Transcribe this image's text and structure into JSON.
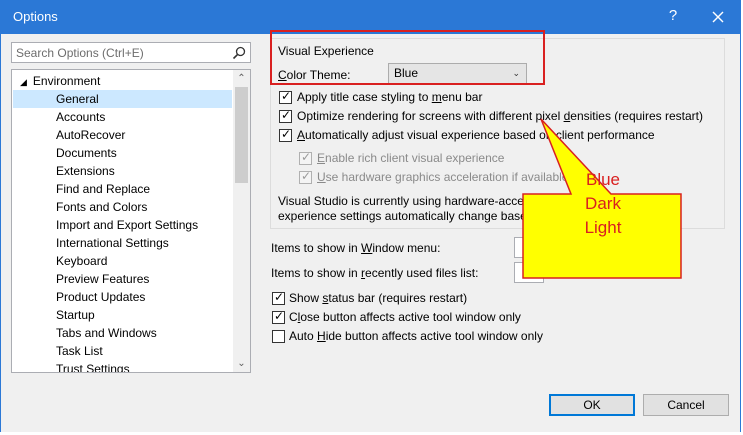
{
  "window": {
    "title": "Options",
    "help_label": "?"
  },
  "search": {
    "placeholder": "Search Options (Ctrl+E)"
  },
  "tree": {
    "root_label": "Environment",
    "items": [
      "General",
      "Accounts",
      "AutoRecover",
      "Documents",
      "Extensions",
      "Find and Replace",
      "Fonts and Colors",
      "Import and Export Settings",
      "International Settings",
      "Keyboard",
      "Preview Features",
      "Product Updates",
      "Startup",
      "Tabs and Windows",
      "Task List",
      "Trust Settings"
    ]
  },
  "visual_experience": {
    "group_label": "Visual Experience",
    "color_theme_label_pre": "",
    "color_theme_label_ul": "C",
    "color_theme_label_post": "olor Theme:",
    "color_theme_value": "Blue",
    "checkboxes": [
      {
        "pre": "Apply title case styling to ",
        "ul": "m",
        "post": "enu bar"
      },
      {
        "pre": "Optimize rendering for screens with different pixel ",
        "ul": "d",
        "post": "ensities (requires restart)"
      },
      {
        "pre": "",
        "ul": "A",
        "post": "utomatically adjust visual experience based on client performance"
      },
      {
        "pre": "",
        "ul": "E",
        "post": "nable rich client visual experience"
      },
      {
        "pre": "",
        "ul": "U",
        "post": "se hardware graphics acceleration if available"
      }
    ],
    "info_line1": "Visual Studio is currently using hardware-accelerated rendering. The visual",
    "info_line2": "experience settings automatically change based on system capabilities."
  },
  "window_menu": {
    "pre": "Items to show in ",
    "ul": "W",
    "post": "indow menu:"
  },
  "recent_files": {
    "pre": "Items to show in ",
    "ul": "r",
    "post": "ecently used files list:"
  },
  "bottom_checks": [
    {
      "pre": "Show ",
      "ul": "s",
      "post": "tatus bar (requires restart)"
    },
    {
      "pre": "C",
      "ul": "l",
      "post": "ose button affects active tool window only"
    },
    {
      "pre": "Auto ",
      "ul": "H",
      "post": "ide button affects active tool window only"
    }
  ],
  "buttons": {
    "ok": "OK",
    "cancel": "Cancel"
  },
  "callout": {
    "line1": "Blue",
    "line2": "Dark",
    "line3": "Light"
  },
  "colors": {
    "titlebar": "#2b78d6",
    "selection": "#cce8ff",
    "callout_fill": "#ffff00",
    "callout_border": "#d92020"
  }
}
